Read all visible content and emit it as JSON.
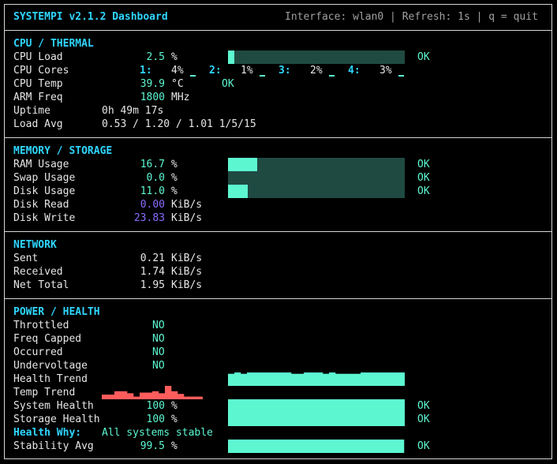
{
  "header": {
    "title": "SYSTEMPI v2.1.2 Dashboard",
    "info": "Interface: wlan0 | Refresh: 1s | q = quit"
  },
  "cpu": {
    "title": "CPU / THERMAL",
    "load_label": "CPU Load",
    "load_value": "2.5",
    "load_unit": "%",
    "load_fraction": 0.025,
    "load_status": "OK",
    "cores_label": "CPU Cores",
    "cores": [
      {
        "id": "1:",
        "value": "4%"
      },
      {
        "id": "2:",
        "value": "1%"
      },
      {
        "id": "3:",
        "value": "2%"
      },
      {
        "id": "4:",
        "value": "3%"
      }
    ],
    "temp_label": "CPU Temp",
    "temp_value": "39.9",
    "temp_unit": "°C",
    "temp_status": "OK",
    "freq_label": "ARM Freq",
    "freq_value": "1800",
    "freq_unit": "MHz",
    "uptime_label": "Uptime",
    "uptime_value": "0h 49m 17s",
    "loadavg_label": "Load Avg",
    "loadavg_value": "0.53 / 1.20 / 1.01 1/5/15"
  },
  "memory": {
    "title": "MEMORY / STORAGE",
    "rows": [
      {
        "label": "RAM Usage",
        "value": "16.7",
        "unit": "%",
        "fraction": 0.167,
        "status": "OK"
      },
      {
        "label": "Swap Usage",
        "value": "0.0",
        "unit": "%",
        "fraction": 0.0,
        "status": "OK"
      },
      {
        "label": "Disk Usage",
        "value": "11.0",
        "unit": "%",
        "fraction": 0.11,
        "status": "OK"
      }
    ],
    "read_label": "Disk Read",
    "read_value": "0.00",
    "read_unit": "KiB/s",
    "write_label": "Disk Write",
    "write_value": "23.83",
    "write_unit": "KiB/s"
  },
  "network": {
    "title": "NETWORK",
    "rows": [
      {
        "label": "Sent",
        "value": "0.21",
        "unit": "KiB/s"
      },
      {
        "label": "Received",
        "value": "1.74",
        "unit": "KiB/s"
      },
      {
        "label": "Net Total",
        "value": "1.95",
        "unit": "KiB/s"
      }
    ]
  },
  "power": {
    "title": "POWER / HEALTH",
    "flags": [
      {
        "label": "Throttled",
        "value": "NO"
      },
      {
        "label": "Freq Capped",
        "value": "NO"
      },
      {
        "label": "Occurred",
        "value": "NO"
      },
      {
        "label": "Undervoltage",
        "value": "NO"
      }
    ],
    "health_trend_label": "Health Trend",
    "health_trend": [
      0.9,
      0.9,
      1,
      1,
      0.9,
      0.9,
      1,
      1,
      1,
      1,
      1,
      1,
      1,
      1,
      1,
      1,
      1,
      1,
      1,
      1,
      0.9,
      0.9,
      0.9,
      0.9,
      1,
      1,
      1,
      1,
      1,
      1,
      0.9,
      0.9,
      1,
      1,
      0.9,
      0.9,
      0.9,
      0.9,
      0.9,
      0.9,
      0.9,
      0.9,
      1,
      1,
      1,
      1,
      1,
      1,
      1,
      1,
      1,
      1,
      1,
      1,
      1,
      1
    ],
    "temp_trend_label": "Temp Trend",
    "temp_trend": [
      0.35,
      0.35,
      0.35,
      0.35,
      0.6,
      0.6,
      0.6,
      0.6,
      0.45,
      0.45,
      0.2,
      0.2,
      0.5,
      0.5,
      0.5,
      0.5,
      0.6,
      0.6,
      0.45,
      0.45,
      1,
      1,
      0.6,
      0.6,
      0.4,
      0.4,
      0.2,
      0.2,
      0.2,
      0.2,
      0.2,
      0.2
    ],
    "system_label": "System Health",
    "system_value": "100",
    "system_unit": "%",
    "system_fraction": 1.0,
    "system_status": "OK",
    "storage_label": "Storage Health",
    "storage_value": "100",
    "storage_unit": "%",
    "storage_fraction": 1.0,
    "storage_status": "OK",
    "why_label": "Health Why:",
    "why_value": "All systems stable",
    "stability_label": "Stability Avg",
    "stability_value": "99.5",
    "stability_unit": "%",
    "stability_fraction": 0.995,
    "stability_status": "OK"
  },
  "colors": {
    "accent": "#2fd6ff",
    "ok": "#5cf7d1",
    "bar_bg": "#1f4a42",
    "trend_temp": "#ff5c5c",
    "io_read": "#8b6cff"
  }
}
